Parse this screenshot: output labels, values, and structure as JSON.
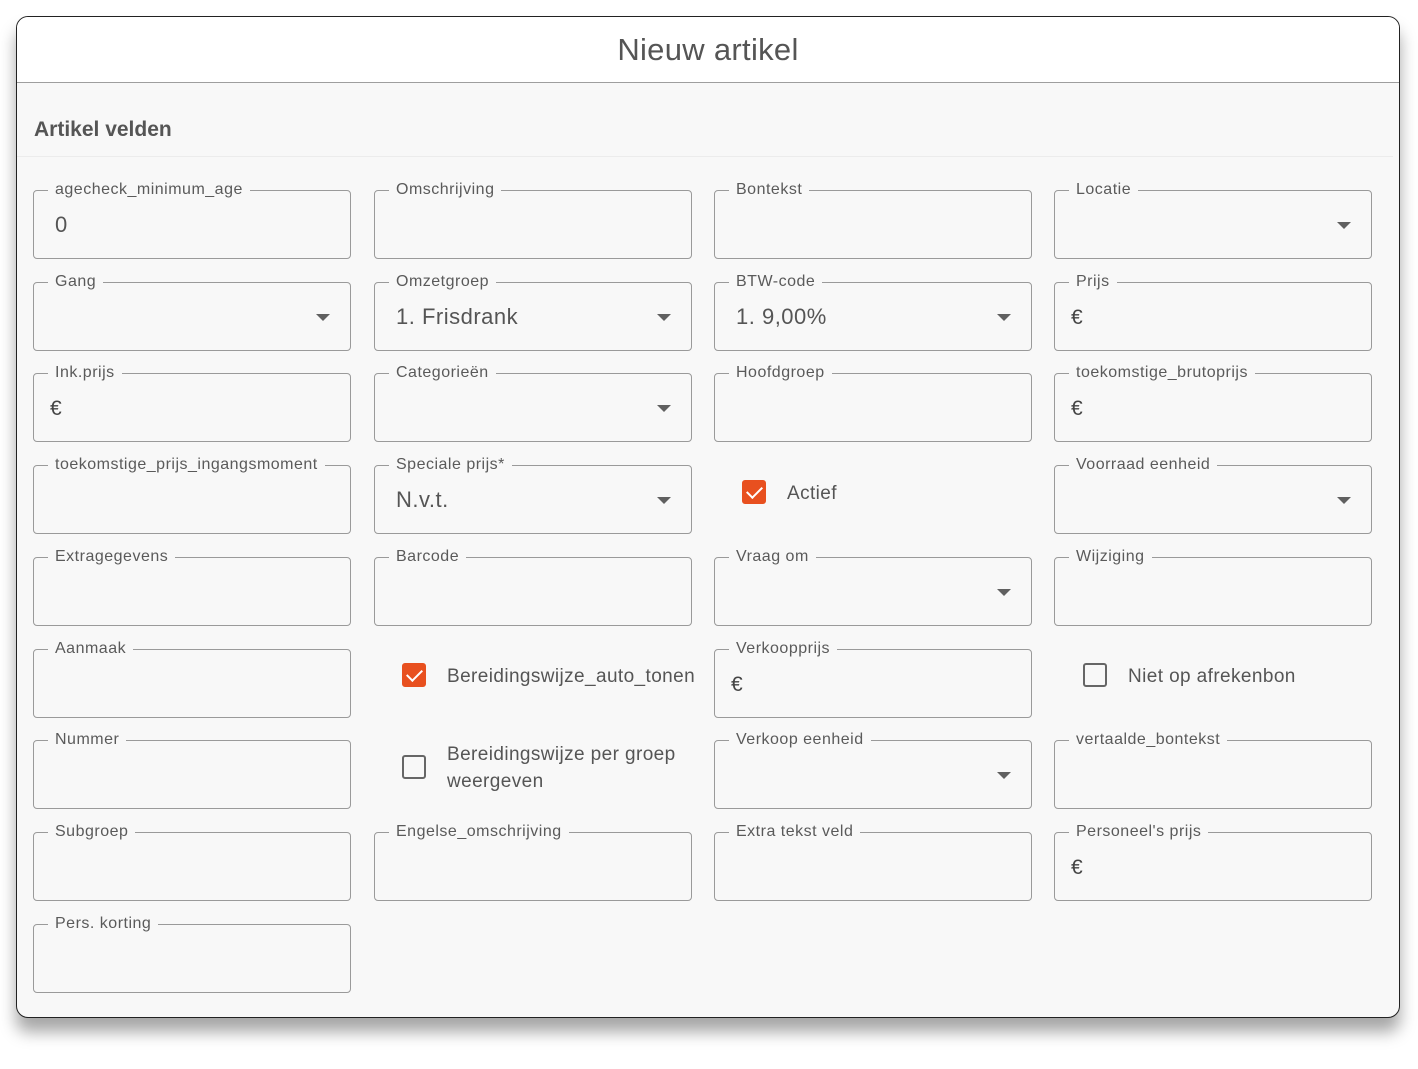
{
  "dialog": {
    "title": "Nieuw artikel",
    "section_title": "Artikel velden"
  },
  "fields": {
    "agecheck": {
      "label": "agecheck_minimum_age",
      "value": "0"
    },
    "omschrijving": {
      "label": "Omschrijving"
    },
    "bontekst": {
      "label": "Bontekst"
    },
    "locatie": {
      "label": "Locatie"
    },
    "gang": {
      "label": "Gang"
    },
    "omzetgroep": {
      "label": "Omzetgroep",
      "value": "1. Frisdrank"
    },
    "btw_code": {
      "label": "BTW-code",
      "value": "1. 9,00%"
    },
    "prijs": {
      "label": "Prijs",
      "prefix": "€"
    },
    "ink_prijs": {
      "label": "Ink.prijs",
      "prefix": "€"
    },
    "categorieen": {
      "label": "Categorieën"
    },
    "hoofdgroep": {
      "label": "Hoofdgroep"
    },
    "toekomstige_brutoprijs": {
      "label": "toekomstige_brutoprijs",
      "prefix": "€"
    },
    "toekomstige_prijs_ingangsmoment": {
      "label": "toekomstige_prijs_ingangsmoment"
    },
    "speciale_prijs": {
      "label": "Speciale prijs*",
      "value": "N.v.t."
    },
    "voorraad_eenheid": {
      "label": "Voorraad eenheid"
    },
    "extragegevens": {
      "label": "Extragegevens"
    },
    "barcode": {
      "label": "Barcode"
    },
    "vraag_om": {
      "label": "Vraag om"
    },
    "wijziging": {
      "label": "Wijziging"
    },
    "aanmaak": {
      "label": "Aanmaak"
    },
    "verkoopprijs": {
      "label": "Verkoopprijs",
      "prefix": "€"
    },
    "nummer": {
      "label": "Nummer"
    },
    "verkoop_eenheid": {
      "label": "Verkoop eenheid"
    },
    "vertaalde_bontekst": {
      "label": "vertaalde_bontekst"
    },
    "subgroep": {
      "label": "Subgroep"
    },
    "engelse_omschrijving": {
      "label": "Engelse_omschrijving"
    },
    "extra_tekst_veld": {
      "label": "Extra tekst veld"
    },
    "personeels_prijs": {
      "label": "Personeel's prijs",
      "prefix": "€"
    },
    "pers_korting": {
      "label": "Pers. korting"
    }
  },
  "checkboxes": {
    "actief": {
      "label": "Actief",
      "checked": true
    },
    "bereidingswijze_auto_tonen": {
      "label": "Bereidingswijze_auto_tonen",
      "checked": true
    },
    "niet_op_afrekenbon": {
      "label": "Niet op afrekenbon",
      "checked": false
    },
    "bereidingswijze_per_groep": {
      "label": "Bereidingswijze per groep weergeven",
      "checked": false
    }
  },
  "colors": {
    "accent": "#e8501f",
    "border": "#9a9a9a",
    "background": "#f8f8f8"
  },
  "icons": {
    "dropdown": "arrow-drop-down-icon",
    "checked": "check-icon"
  }
}
